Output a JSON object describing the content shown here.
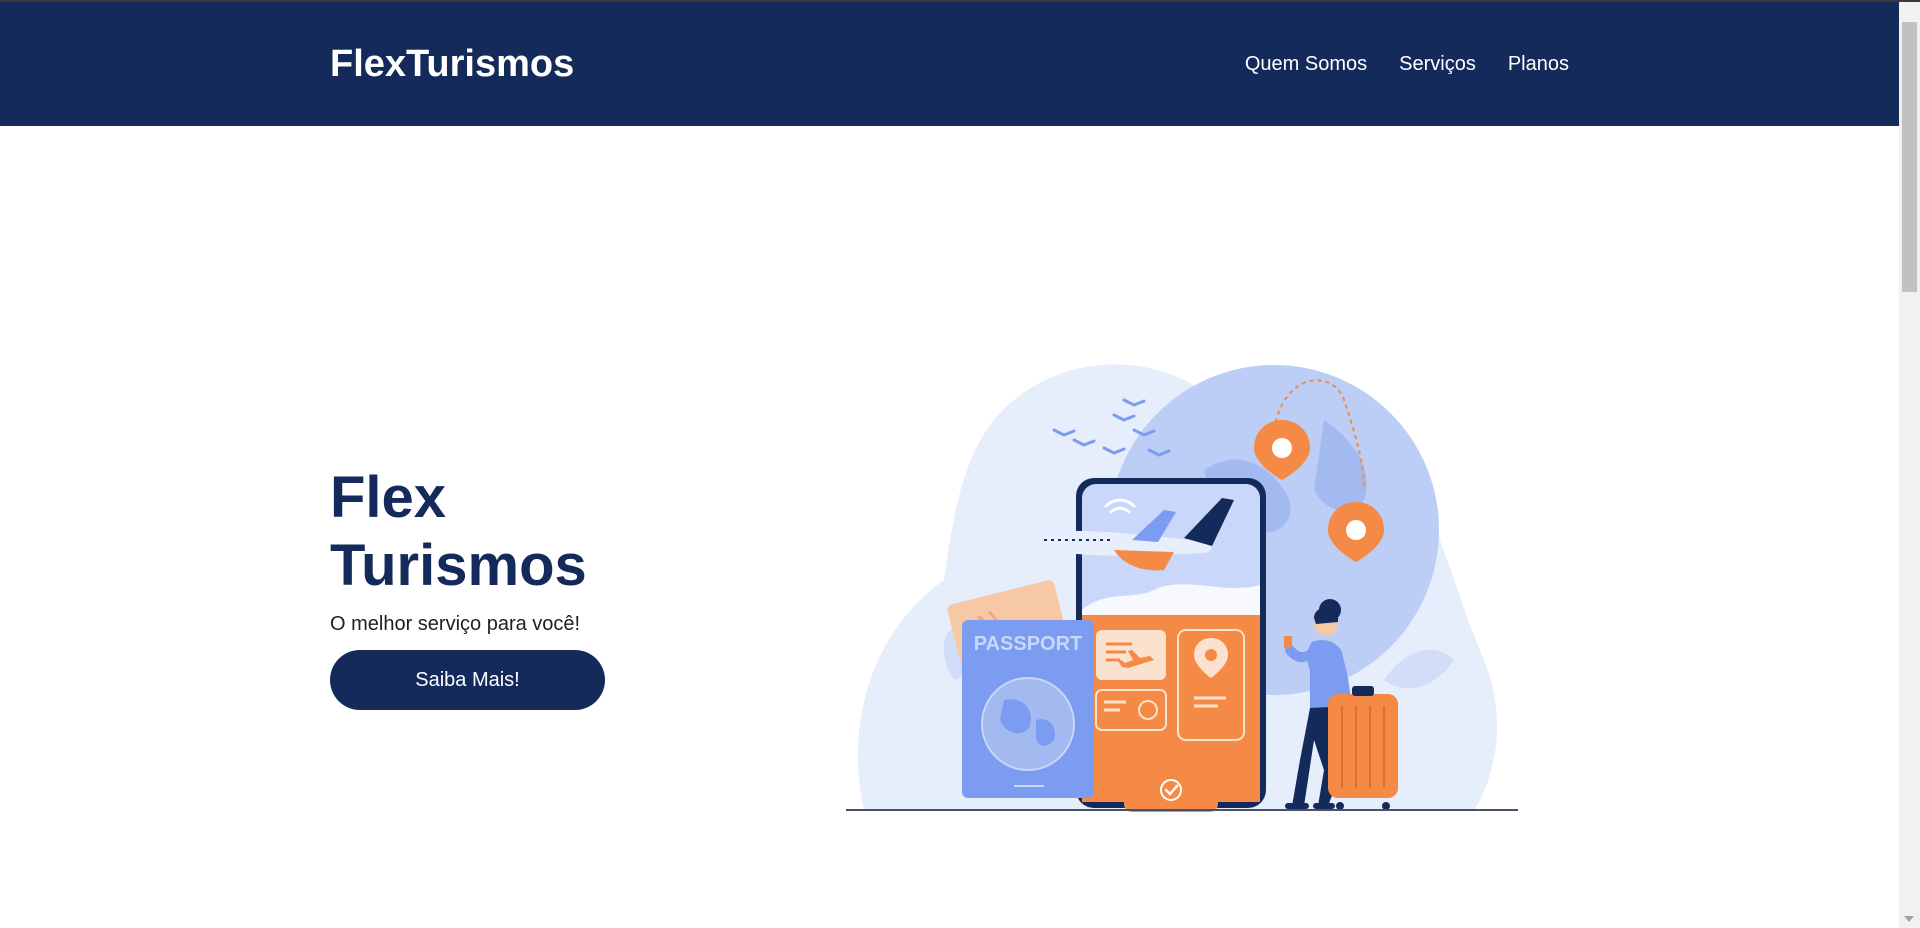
{
  "header": {
    "logo": "FlexTurismos",
    "nav": [
      "Quem Somos",
      "Serviços",
      "Planos"
    ]
  },
  "hero": {
    "title_line1": "Flex",
    "title_line2": "Turismos",
    "subtitle": "O melhor serviço para você!",
    "cta_label": "Saiba Mais!",
    "passport_label": "PASSPORT"
  },
  "colors": {
    "primary": "#132a5a",
    "accent_orange": "#f48a45",
    "accent_blue": "#7b9cf0",
    "light_blue": "#dfe8fb"
  },
  "icons": [
    "airplane-icon",
    "location-pin-icon",
    "wifi-icon",
    "checkmark-icon"
  ]
}
